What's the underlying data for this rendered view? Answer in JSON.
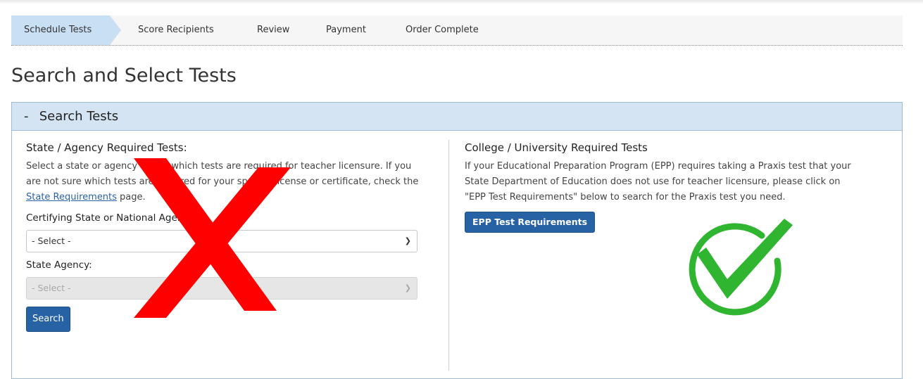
{
  "steps": [
    "Schedule Tests",
    "Score Recipients",
    "Review",
    "Payment",
    "Order Complete"
  ],
  "page_title": "Search and Select Tests",
  "panel": {
    "toggle": "-",
    "title": "Search Tests"
  },
  "left": {
    "title": "State / Agency Required Tests:",
    "desc_1": "Select a state or agency to see which tests are required for teacher licensure. If you are not sure which tests are required for your specific license or certificate, check the ",
    "desc_link": "State Requirements",
    "desc_2": " page.",
    "certifying_label": "Certifying State or National Agency:",
    "certifying_value": "- Select -",
    "agency_label": "State Agency:",
    "agency_value": "- Select -",
    "search_button": "Search"
  },
  "right": {
    "title": "College / University Required Tests",
    "desc": "If your Educational Preparation Program (EPP) requires taking a Praxis test that your State Department of Education does not use for teacher licensure, please click on \"EPP Test Requirements\" below to search for the Praxis test you need.",
    "epp_button": "EPP Test Requirements"
  },
  "colors": {
    "accent": "#2762a5",
    "active_step": "#c9dff3",
    "panel_header": "#d4e4f2",
    "cross": "#ff0000",
    "check": "#2fb52f"
  },
  "icons": {
    "dropdown": "chevron-down-icon",
    "cross_overlay": "red-x-icon",
    "check_overlay": "green-check-circle-icon"
  }
}
